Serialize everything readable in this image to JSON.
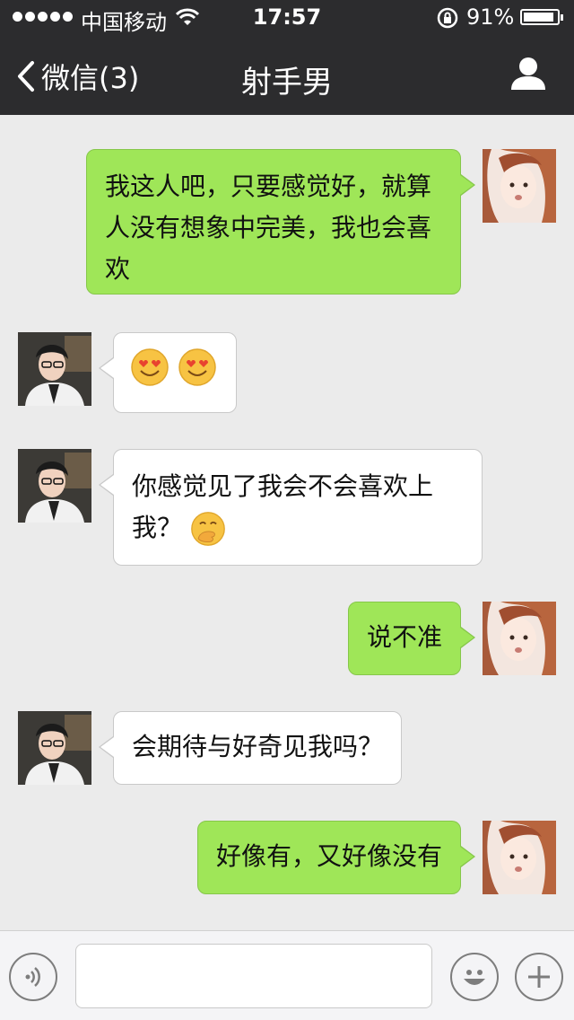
{
  "status_bar": {
    "carrier": "中国移动",
    "time": "17:57",
    "battery_percent_text": "91%",
    "battery_level": 0.91,
    "icons": [
      "signal-dots-icon",
      "wifi-icon",
      "orientation-lock-icon",
      "battery-icon"
    ]
  },
  "nav": {
    "back_label": "微信(3)",
    "title": "射手男",
    "profile_icon": "person-icon"
  },
  "colors": {
    "nav_bg": "#2c2c2e",
    "chat_bg": "#ebebeb",
    "outgoing_bubble": "#9fe658",
    "incoming_bubble": "#ffffff"
  },
  "messages": [
    {
      "side": "right",
      "text": "我这人吧，只要感觉好，就算人没有想象中完美，我也会喜欢"
    },
    {
      "side": "left",
      "text": "",
      "emoji": [
        "heart-eyes-emoji",
        "heart-eyes-emoji"
      ]
    },
    {
      "side": "left",
      "text": "你感觉见了我会不会喜欢上我？",
      "emoji": [
        "hand-over-mouth-emoji"
      ]
    },
    {
      "side": "right",
      "text": "说不准"
    },
    {
      "side": "left",
      "text": "会期待与好奇见我吗？"
    },
    {
      "side": "right",
      "text": "好像有，又好像没有"
    }
  ],
  "input_bar": {
    "placeholder": "",
    "icons": [
      "voice-icon",
      "emoji-face-icon",
      "plus-icon"
    ]
  }
}
